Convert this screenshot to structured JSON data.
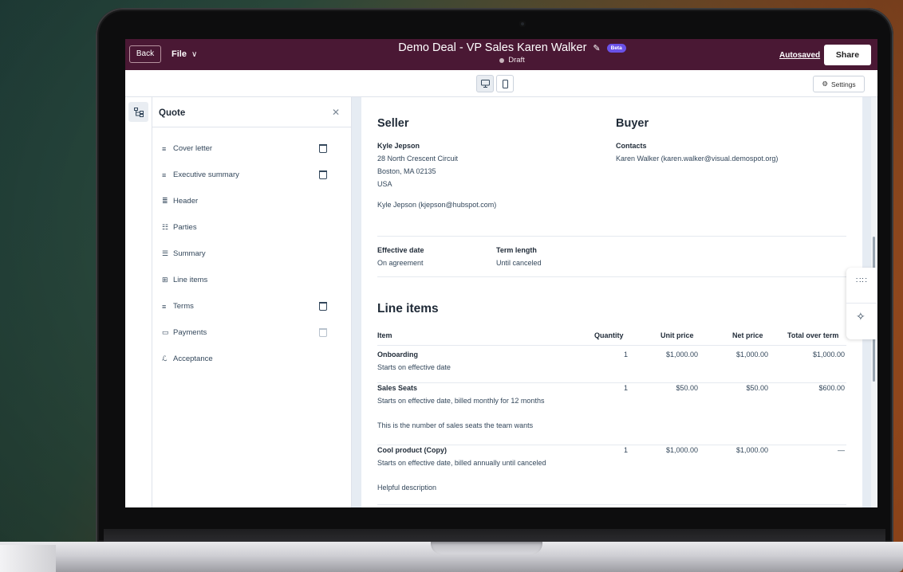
{
  "topbar": {
    "back_label": "Back",
    "file_label": "File",
    "doc_title": "Demo Deal - VP Sales Karen Walker",
    "beta_label": "Beta",
    "status": "Draft",
    "autosaved": "Autosaved",
    "share_label": "Share"
  },
  "subbar": {
    "settings_label": "Settings"
  },
  "panel": {
    "title": "Quote",
    "sections": [
      {
        "label": "Cover letter",
        "icon": "text-icon",
        "deletable": true
      },
      {
        "label": "Executive summary",
        "icon": "text-icon",
        "deletable": true
      },
      {
        "label": "Header",
        "icon": "header-icon",
        "deletable": false
      },
      {
        "label": "Parties",
        "icon": "parties-icon",
        "deletable": false
      },
      {
        "label": "Summary",
        "icon": "summary-icon",
        "deletable": false
      },
      {
        "label": "Line items",
        "icon": "table-icon",
        "deletable": false
      },
      {
        "label": "Terms",
        "icon": "text-icon",
        "deletable": true
      },
      {
        "label": "Payments",
        "icon": "payment-icon",
        "deletable": true
      },
      {
        "label": "Acceptance",
        "icon": "signature-icon",
        "deletable": false
      }
    ]
  },
  "document": {
    "seller": {
      "heading": "Seller",
      "name": "Kyle Jepson",
      "address1": "28 North Crescent Circuit",
      "address2": "Boston, MA 02135",
      "country": "USA",
      "contact": "Kyle Jepson (kjepson@hubspot.com)"
    },
    "buyer": {
      "heading": "Buyer",
      "contacts_label": "Contacts",
      "contact": "Karen Walker (karen.walker@visual.demospot.org)"
    },
    "terms": {
      "effective_label": "Effective date",
      "effective_value": "On agreement",
      "term_label": "Term length",
      "term_value": "Until canceled"
    },
    "line_items": {
      "heading": "Line items",
      "columns": [
        "Item",
        "Quantity",
        "Unit price",
        "Net price",
        "Total over term"
      ],
      "rows": [
        {
          "name": "Onboarding",
          "desc": "Starts on effective date",
          "note": "",
          "qty": "1",
          "unit": "$1,000.00",
          "net": "$1,000.00",
          "total": "$1,000.00"
        },
        {
          "name": "Sales Seats",
          "desc": "Starts on effective date, billed monthly for 12 months",
          "note": "This is the number of sales seats the team wants",
          "qty": "1",
          "unit": "$50.00",
          "net": "$50.00",
          "total": "$600.00"
        },
        {
          "name": "Cool product (Copy)",
          "desc": "Starts on effective date, billed annually until canceled",
          "note": "Helpful description",
          "qty": "1",
          "unit": "$1,000.00",
          "net": "$1,000.00",
          "total": "—"
        }
      ]
    }
  },
  "colors": {
    "topbar_bg": "#4a1834",
    "beta_badge": "#6a52e8",
    "canvas_bg": "#e6ecf3"
  }
}
